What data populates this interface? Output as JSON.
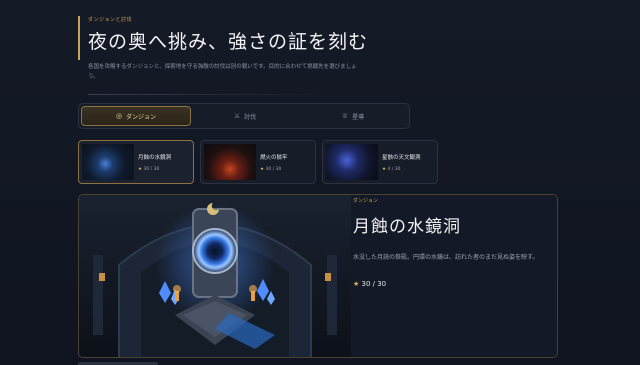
{
  "header": {
    "eyebrow": "ダンジョンと討伐",
    "title": "夜の奥へ挑み、強さの証を刻む",
    "subtitle": "各国を攻略するダンジョンと、探索地を守る強敵の討伐は別の戦いです。目的に合わせて挑戦先を選びましょう。"
  },
  "tabs": [
    {
      "label": "ダンジョン",
      "icon": "compass-icon",
      "active": true
    },
    {
      "label": "討伐",
      "icon": "crossed-swords-icon",
      "active": false
    },
    {
      "label": "星導",
      "icon": "trophy-icon",
      "active": false
    }
  ],
  "cards": [
    {
      "name": "月蝕の水鏡洞",
      "progress": "30 / 30",
      "active": true
    },
    {
      "name": "燃火の獄牢",
      "progress": "30 / 30",
      "active": false
    },
    {
      "name": "星骸の天文観測",
      "progress": "4 / 30",
      "active": false
    }
  ],
  "feature": {
    "eyebrow": "ダンジョン",
    "title": "月蝕の水鏡洞",
    "description": "水没した月読の祭殿。円環の水鏡は、訪れた者のまだ見ぬ姿を映す。",
    "progress": "30 / 30",
    "star": "★"
  },
  "colors": {
    "accent": "#c9a45c",
    "background": "#0f1420",
    "panel": "#161c28"
  }
}
